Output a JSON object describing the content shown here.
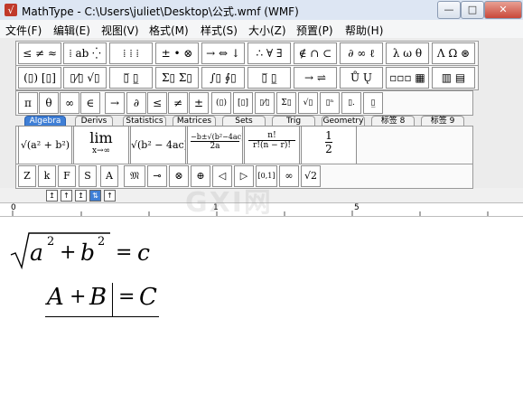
{
  "window": {
    "title": "MathType - C:\\Users\\juliet\\Desktop\\公式.wmf (WMF)",
    "min_label": "—",
    "max_label": "□",
    "close_label": "✕"
  },
  "menu": [
    "文件(F)",
    "编辑(E)",
    "视图(V)",
    "格式(M)",
    "样式(S)",
    "大小(Z)",
    "预置(P)",
    "帮助(H)"
  ],
  "palette_row1": [
    "≤ ≠ ≈",
    "⁞ ab ⁛",
    "⁞ ⁞ ⁞",
    "± • ⊗",
    "→ ⇔ ↓",
    "∴ ∀ ∃",
    "∉ ∩ ⊂",
    "∂ ∞ ℓ",
    "λ ω θ",
    "Λ Ω ⊛"
  ],
  "palette_row2": [
    "(▯) [▯]",
    "▯⁄▯ √▯",
    "▯̅ ▯̲",
    "Σ▯ Σ▯",
    "∫▯ ∮▯",
    "▯̅ ▯̲",
    "→ ⇌",
    "Ů Ų",
    "▫▫▫ ▦",
    "▥ ▤"
  ],
  "symbol_row": [
    "π",
    "θ",
    "∞",
    "∈",
    "→",
    "∂",
    "≤",
    "≠",
    "±",
    "(▯)",
    "[▯]",
    "▯⁄▯",
    "Σ▯",
    "√▯",
    "▯ⁿ",
    "▯.",
    "▯̲"
  ],
  "tabs": [
    "Algebra",
    "Derivs",
    "Statistics",
    "Matrices",
    "Sets",
    "Trig",
    "Geometry",
    "标签 8",
    "标签 9"
  ],
  "templates": {
    "t1": "√(a² + b²)",
    "t2_top": "lim",
    "t2_bottom": "x→∞",
    "t3": "√(b² − 4ac)",
    "t4_num": "−b±√(b²−4ac)",
    "t4_den": "2a",
    "t5_num": "n!",
    "t5_den": "r!(n − r)!",
    "t6_num": "1",
    "t6_den": "2"
  },
  "small_row": [
    "Z",
    "k",
    "F",
    "S",
    "A",
    "𝔐",
    "⊸",
    "⊗",
    "⊕",
    "◁",
    "▷",
    "[0,1]",
    "∞",
    "√2"
  ],
  "size_buttons": [
    "↥",
    "↑",
    "↥",
    "⇅",
    "↑"
  ],
  "ruler": {
    "mark0": "0",
    "mark1": "1",
    "mark5": "5"
  },
  "editor": {
    "eq1_a": "a",
    "eq1_exp1": "2",
    "eq1_plus": "+",
    "eq1_b": "b",
    "eq1_exp2": "2",
    "eq1_eq": "=",
    "eq1_c": "c",
    "eq2_A": "A",
    "eq2_plus": "+",
    "eq2_B": "B",
    "eq2_eq": "=",
    "eq2_C": "C"
  },
  "watermark": "GXI网"
}
